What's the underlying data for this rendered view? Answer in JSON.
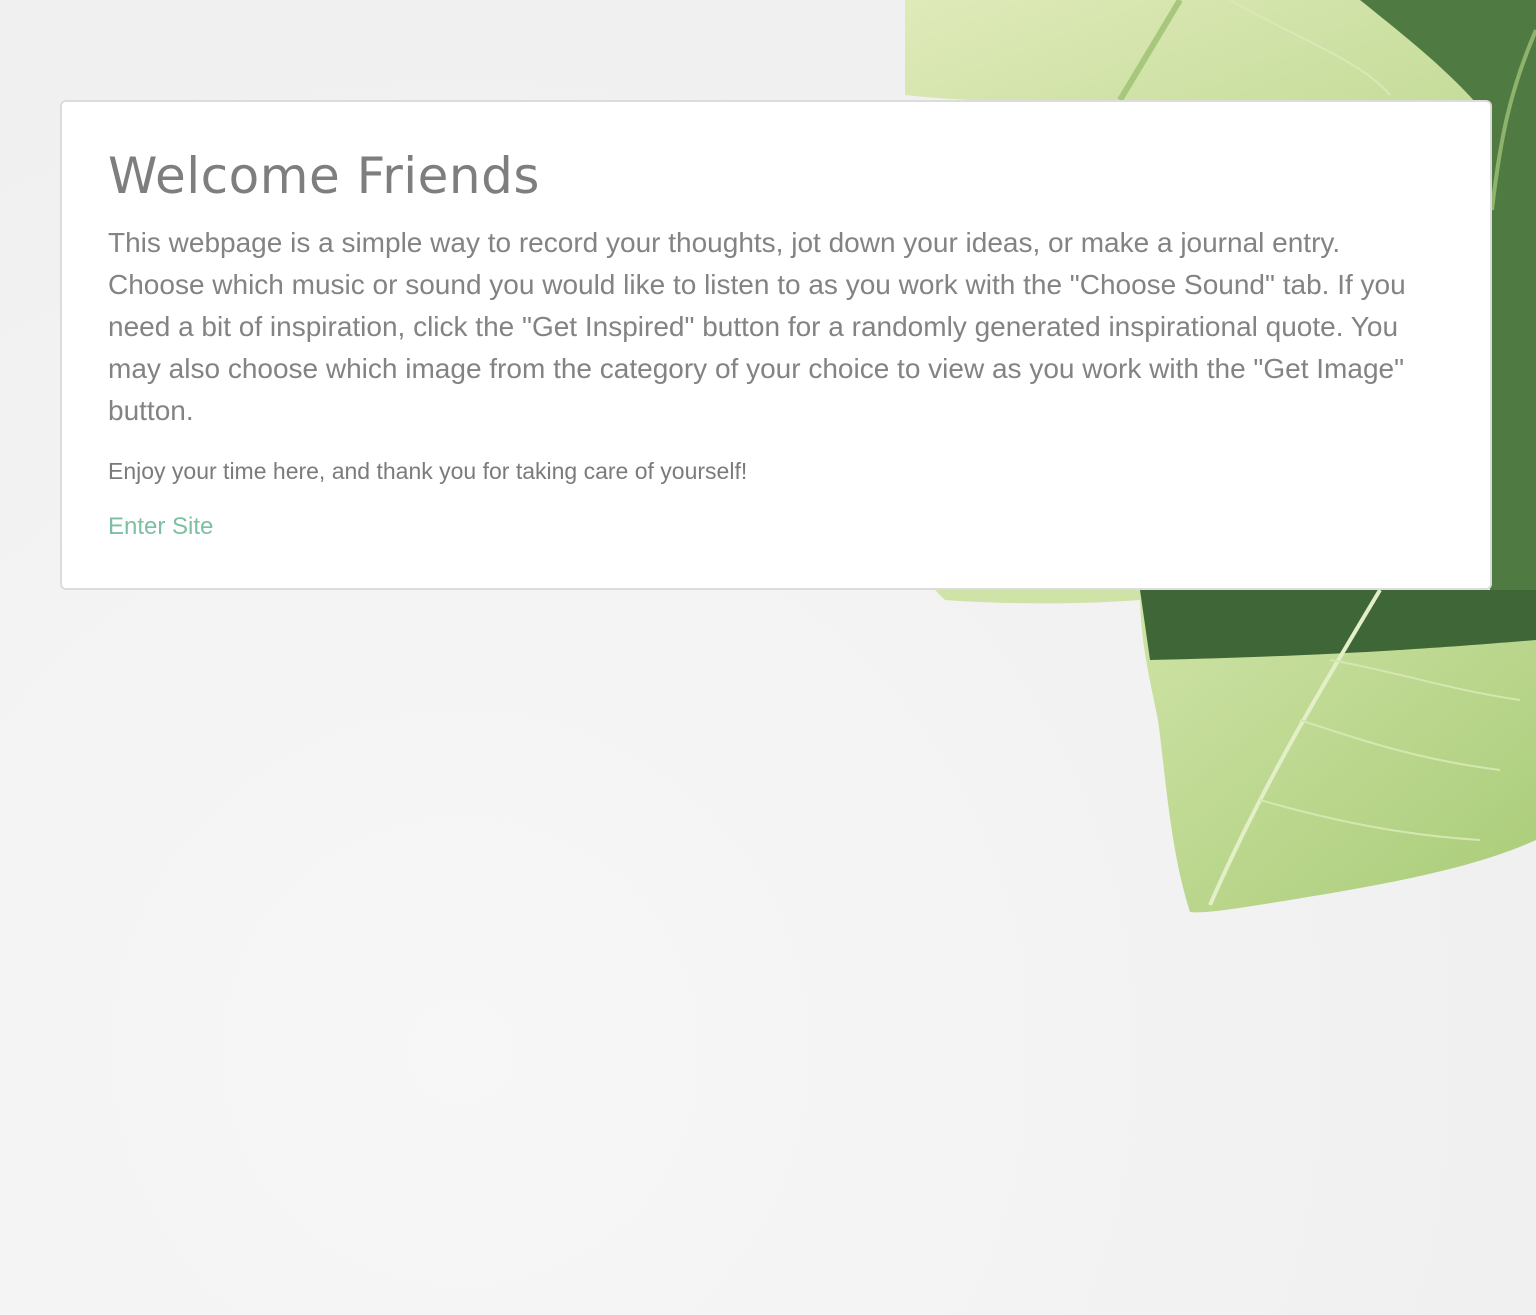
{
  "background": {
    "image": "green-leaf-icon",
    "colors": {
      "page": "#f3f3f3",
      "leaf_light": "#c9dfa4",
      "leaf_dark": "#4e7a3e"
    }
  },
  "welcome": {
    "title": "Welcome Friends",
    "lead": "This webpage is a simple way to record your thoughts, jot down your ideas, or make a journal entry. Choose which music or sound you would like to listen to as you work with the \"Choose Sound\" tab. If you need a bit of inspiration, click the \"Get Inspired\" button for a randomly generated inspirational quote. You may also choose which image from the category of your choice to view as you work with the \"Get Image\" button.",
    "note": "Enjoy your time here, and thank you for taking care of yourself!",
    "enter_label": "Enter Site",
    "colors": {
      "text": "#838383",
      "link": "#7dbfa2"
    }
  }
}
